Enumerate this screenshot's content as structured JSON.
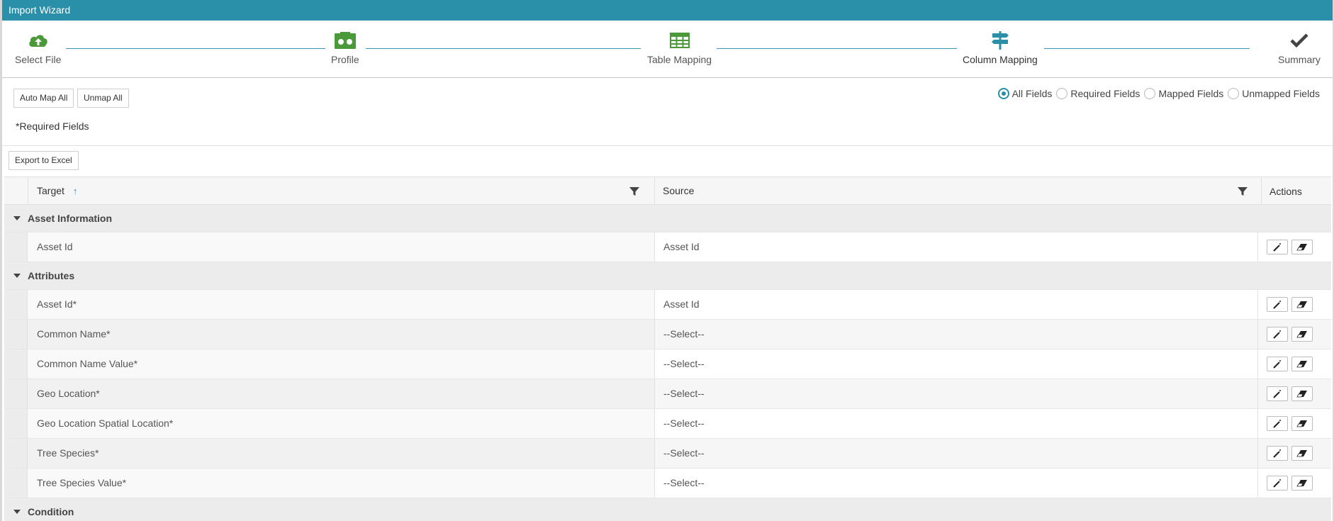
{
  "window": {
    "title": "Import Wizard"
  },
  "steps": [
    {
      "label": "Select File",
      "icon": "cloud-upload-icon",
      "color": "#4a9a3a"
    },
    {
      "label": "Profile",
      "icon": "profile-icon",
      "color": "#4a9a3a"
    },
    {
      "label": "Table Mapping",
      "icon": "table-grid-icon",
      "color": "#4a9a3a"
    },
    {
      "label": "Column Mapping",
      "icon": "signpost-icon",
      "color": "#2a8fa8"
    },
    {
      "label": "Summary",
      "icon": "checkmark-icon",
      "color": "#444444"
    }
  ],
  "toolbar": {
    "auto_map_label": "Auto Map All",
    "unmap_label": "Unmap All",
    "required_note": "*Required Fields",
    "export_label": "Export to Excel"
  },
  "filters": [
    {
      "label": "All Fields",
      "selected": true
    },
    {
      "label": "Required Fields",
      "selected": false
    },
    {
      "label": "Mapped Fields",
      "selected": false
    },
    {
      "label": "Unmapped Fields",
      "selected": false
    }
  ],
  "grid": {
    "columns": {
      "target": "Target",
      "source": "Source",
      "actions": "Actions"
    },
    "groups": [
      {
        "title": "Asset Information",
        "rows": [
          {
            "target": "Asset Id",
            "source": "Asset Id"
          }
        ]
      },
      {
        "title": "Attributes",
        "rows": [
          {
            "target": "Asset Id*",
            "source": "Asset Id"
          },
          {
            "target": "Common Name*",
            "source": "--Select--"
          },
          {
            "target": "Common Name Value*",
            "source": "--Select--"
          },
          {
            "target": "Geo Location*",
            "source": "--Select--"
          },
          {
            "target": "Geo Location Spatial Location*",
            "source": "--Select--"
          },
          {
            "target": "Tree Species*",
            "source": "--Select--"
          },
          {
            "target": "Tree Species Value*",
            "source": "--Select--"
          }
        ]
      },
      {
        "title": "Condition",
        "rows": []
      }
    ]
  },
  "colors": {
    "accent": "#2a8fa8",
    "success": "#4a9a3a"
  }
}
